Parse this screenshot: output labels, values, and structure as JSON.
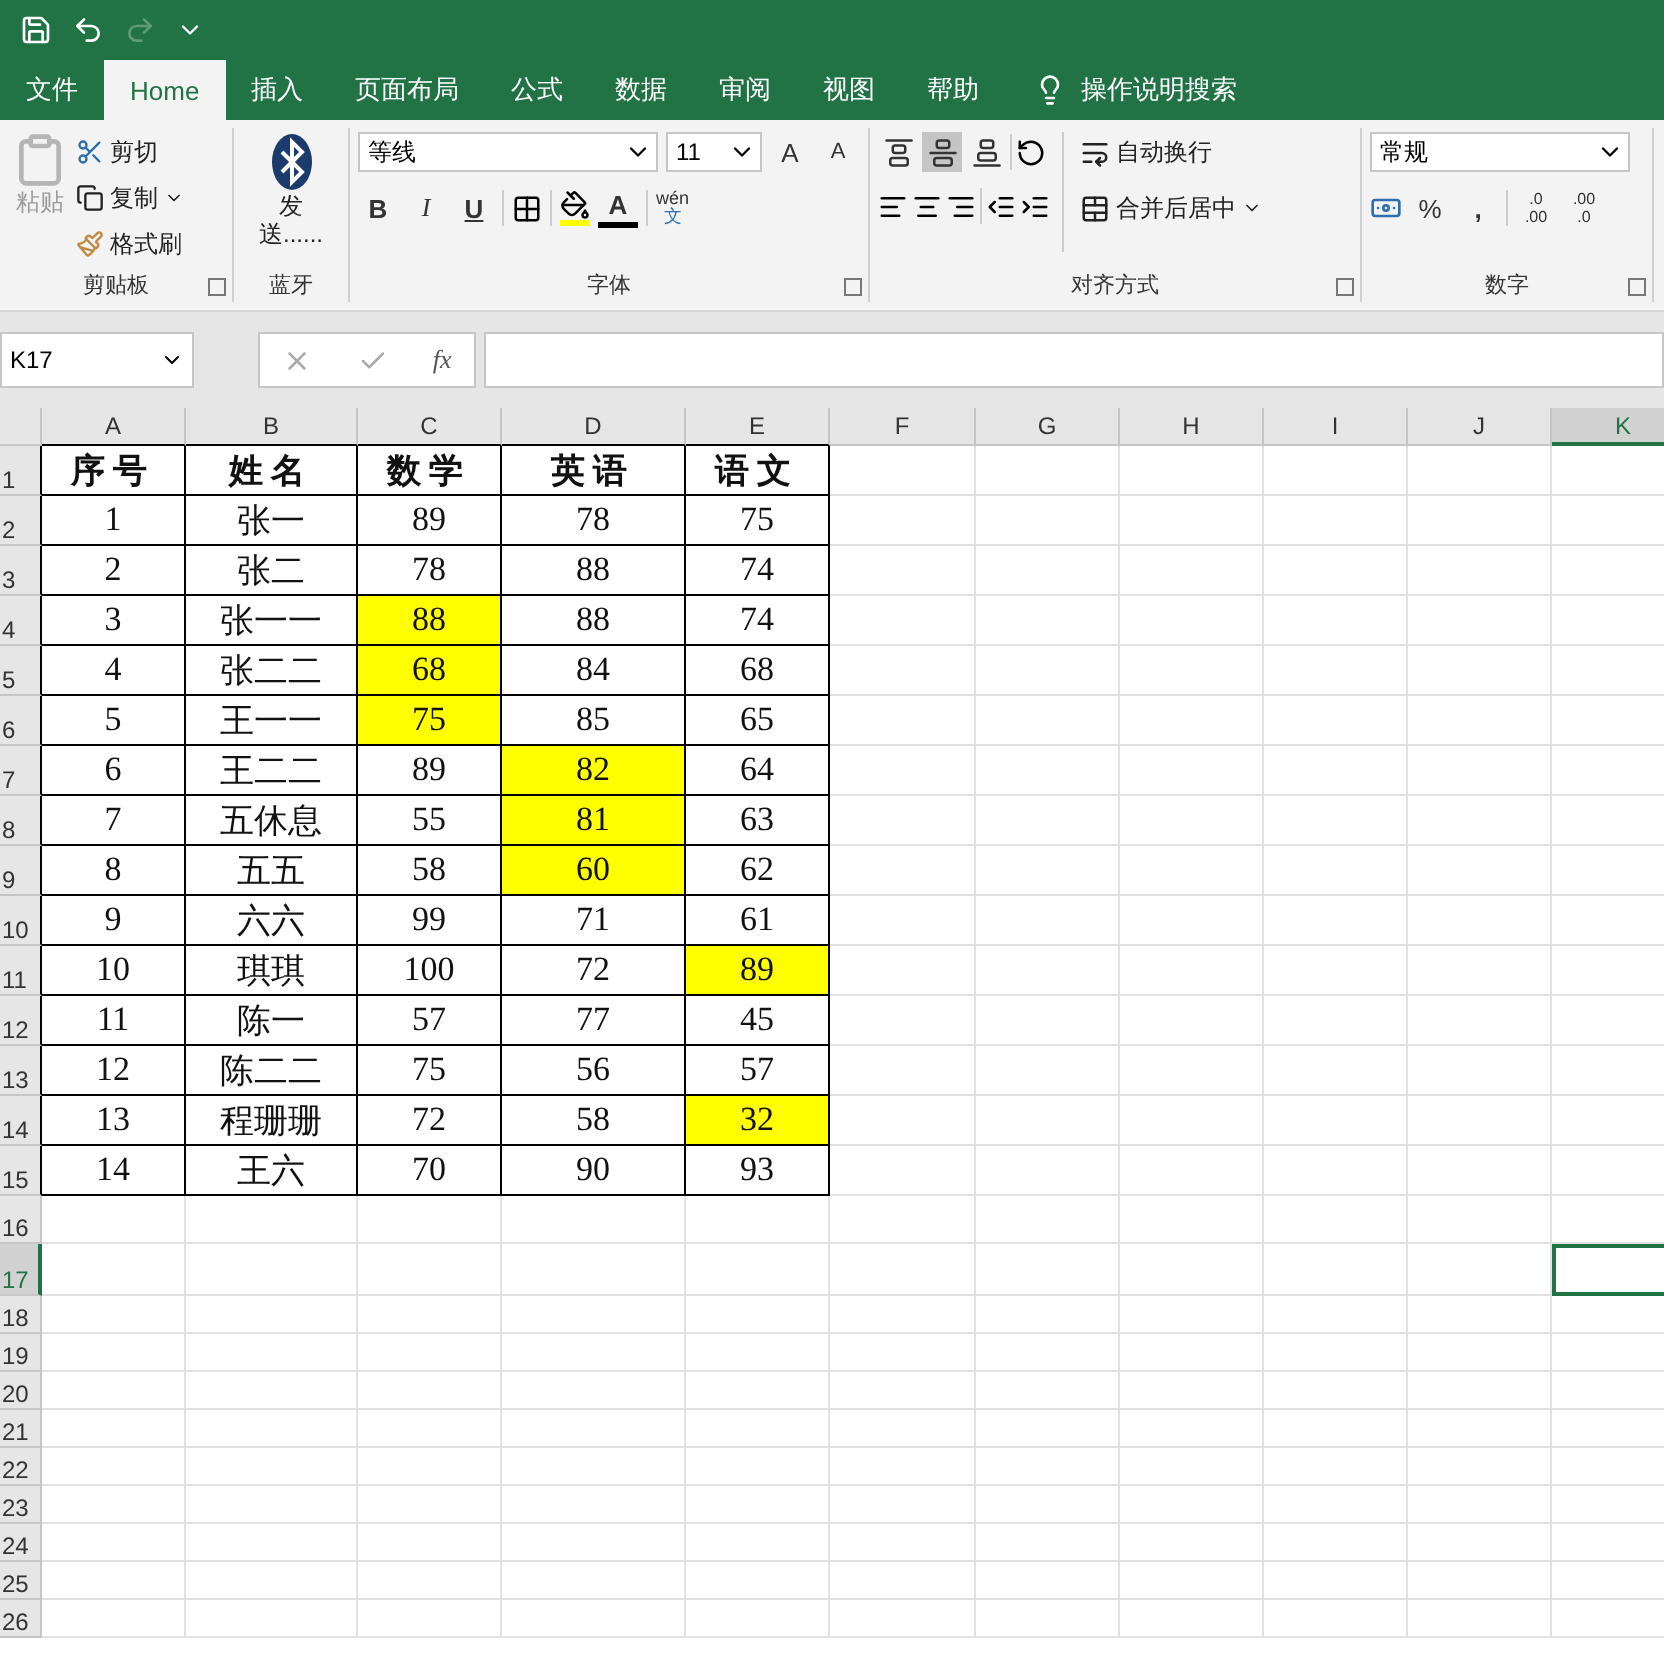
{
  "quick_access": [
    {
      "kind": "save",
      "disabled": false
    },
    {
      "kind": "undo",
      "disabled": false
    },
    {
      "kind": "redo",
      "disabled": true
    },
    {
      "kind": "customize",
      "disabled": false
    }
  ],
  "tabs": [
    {
      "label": "文件",
      "selected": false
    },
    {
      "label": "Home",
      "selected": true
    },
    {
      "label": "插入",
      "selected": false
    },
    {
      "label": "页面布局",
      "selected": false
    },
    {
      "label": "公式",
      "selected": false
    },
    {
      "label": "数据",
      "selected": false
    },
    {
      "label": "审阅",
      "selected": false
    },
    {
      "label": "视图",
      "selected": false
    },
    {
      "label": "帮助",
      "selected": false
    }
  ],
  "tell_me": "操作说明搜索",
  "clipboard": {
    "label": "剪贴板",
    "paste": {
      "label": "粘贴",
      "disabled": true
    },
    "cut": "剪切",
    "copy": "复制",
    "format_painter": "格式刷"
  },
  "bluetooth": {
    "label": "蓝牙",
    "send": "发送......"
  },
  "font": {
    "label": "字体",
    "name": "等线",
    "size": "11",
    "grow": "A",
    "shrink": "A",
    "bold": "B",
    "italic": "I",
    "underline": "U",
    "font_color": "A",
    "phonetic_top": "wén",
    "phonetic_bottom": "文"
  },
  "alignment": {
    "label": "对齐方式",
    "vertical": [
      {
        "kind": "top",
        "selected": false
      },
      {
        "kind": "middle",
        "selected": true
      },
      {
        "kind": "bottom",
        "selected": false
      }
    ],
    "wrap": "自动换行",
    "merge": "合并后居中"
  },
  "number": {
    "label": "数字",
    "format": "常规",
    "percent": "%",
    "comma": ",",
    "increase_decimal": [
      ".0",
      ".00"
    ],
    "decrease_decimal": [
      ".00",
      ".0"
    ]
  },
  "formula_bar": {
    "name_box": "K17",
    "function": "fx"
  },
  "columns": [
    {
      "letter": "A",
      "selected": false
    },
    {
      "letter": "B",
      "selected": false
    },
    {
      "letter": "C",
      "selected": false
    },
    {
      "letter": "D",
      "selected": false
    },
    {
      "letter": "E",
      "selected": false
    },
    {
      "letter": "F",
      "selected": false
    },
    {
      "letter": "G",
      "selected": false
    },
    {
      "letter": "H",
      "selected": false
    },
    {
      "letter": "I",
      "selected": false
    },
    {
      "letter": "J",
      "selected": false
    },
    {
      "letter": "K",
      "selected": true
    }
  ],
  "rows": [
    {
      "number": "1",
      "kind": "header",
      "selected": false,
      "cells": [
        {
          "text": "序号",
          "highlighted": false
        },
        {
          "text": "姓名",
          "highlighted": false
        },
        {
          "text": "数学",
          "highlighted": false
        },
        {
          "text": "英语",
          "highlighted": false
        },
        {
          "text": "语文",
          "highlighted": false
        }
      ]
    },
    {
      "number": "2",
      "kind": "data",
      "selected": false,
      "cells": [
        {
          "text": "1",
          "highlighted": false
        },
        {
          "text": "张一",
          "highlighted": false
        },
        {
          "text": "89",
          "highlighted": false
        },
        {
          "text": "78",
          "highlighted": false
        },
        {
          "text": "75",
          "highlighted": false
        }
      ]
    },
    {
      "number": "3",
      "kind": "data",
      "selected": false,
      "cells": [
        {
          "text": "2",
          "highlighted": false
        },
        {
          "text": "张二",
          "highlighted": false
        },
        {
          "text": "78",
          "highlighted": false
        },
        {
          "text": "88",
          "highlighted": false
        },
        {
          "text": "74",
          "highlighted": false
        }
      ]
    },
    {
      "number": "4",
      "kind": "data",
      "selected": false,
      "cells": [
        {
          "text": "3",
          "highlighted": false
        },
        {
          "text": "张一一",
          "highlighted": false
        },
        {
          "text": "88",
          "highlighted": true
        },
        {
          "text": "88",
          "highlighted": false
        },
        {
          "text": "74",
          "highlighted": false
        }
      ]
    },
    {
      "number": "5",
      "kind": "data",
      "selected": false,
      "cells": [
        {
          "text": "4",
          "highlighted": false
        },
        {
          "text": "张二二",
          "highlighted": false
        },
        {
          "text": "68",
          "highlighted": true
        },
        {
          "text": "84",
          "highlighted": false
        },
        {
          "text": "68",
          "highlighted": false
        }
      ]
    },
    {
      "number": "6",
      "kind": "data",
      "selected": false,
      "cells": [
        {
          "text": "5",
          "highlighted": false
        },
        {
          "text": "王一一",
          "highlighted": false
        },
        {
          "text": "75",
          "highlighted": true
        },
        {
          "text": "85",
          "highlighted": false
        },
        {
          "text": "65",
          "highlighted": false
        }
      ]
    },
    {
      "number": "7",
      "kind": "data",
      "selected": false,
      "cells": [
        {
          "text": "6",
          "highlighted": false
        },
        {
          "text": "王二二",
          "highlighted": false
        },
        {
          "text": "89",
          "highlighted": false
        },
        {
          "text": "82",
          "highlighted": true
        },
        {
          "text": "64",
          "highlighted": false
        }
      ]
    },
    {
      "number": "8",
      "kind": "data",
      "selected": false,
      "cells": [
        {
          "text": "7",
          "highlighted": false
        },
        {
          "text": "五休息",
          "highlighted": false
        },
        {
          "text": "55",
          "highlighted": false
        },
        {
          "text": "81",
          "highlighted": true
        },
        {
          "text": "63",
          "highlighted": false
        }
      ]
    },
    {
      "number": "9",
      "kind": "data",
      "selected": false,
      "cells": [
        {
          "text": "8",
          "highlighted": false
        },
        {
          "text": "五五",
          "highlighted": false
        },
        {
          "text": "58",
          "highlighted": false
        },
        {
          "text": "60",
          "highlighted": true
        },
        {
          "text": "62",
          "highlighted": false
        }
      ]
    },
    {
      "number": "10",
      "kind": "data",
      "selected": false,
      "cells": [
        {
          "text": "9",
          "highlighted": false
        },
        {
          "text": "六六",
          "highlighted": false
        },
        {
          "text": "99",
          "highlighted": false
        },
        {
          "text": "71",
          "highlighted": false
        },
        {
          "text": "61",
          "highlighted": false
        }
      ]
    },
    {
      "number": "11",
      "kind": "data",
      "selected": false,
      "cells": [
        {
          "text": "10",
          "highlighted": false
        },
        {
          "text": "琪琪",
          "highlighted": false
        },
        {
          "text": "100",
          "highlighted": false
        },
        {
          "text": "72",
          "highlighted": false
        },
        {
          "text": "89",
          "highlighted": true
        }
      ]
    },
    {
      "number": "12",
      "kind": "data",
      "selected": false,
      "cells": [
        {
          "text": "11",
          "highlighted": false
        },
        {
          "text": "陈一",
          "highlighted": false
        },
        {
          "text": "57",
          "highlighted": false
        },
        {
          "text": "77",
          "highlighted": false
        },
        {
          "text": "45",
          "highlighted": false
        }
      ]
    },
    {
      "number": "13",
      "kind": "data",
      "selected": false,
      "cells": [
        {
          "text": "12",
          "highlighted": false
        },
        {
          "text": "陈二二",
          "highlighted": false
        },
        {
          "text": "75",
          "highlighted": false
        },
        {
          "text": "56",
          "highlighted": false
        },
        {
          "text": "57",
          "highlighted": false
        }
      ]
    },
    {
      "number": "14",
      "kind": "data",
      "selected": false,
      "cells": [
        {
          "text": "13",
          "highlighted": false
        },
        {
          "text": "程珊珊",
          "highlighted": false
        },
        {
          "text": "72",
          "highlighted": false
        },
        {
          "text": "58",
          "highlighted": false
        },
        {
          "text": "32",
          "highlighted": true
        }
      ]
    },
    {
      "number": "15",
      "kind": "data",
      "selected": false,
      "cells": [
        {
          "text": "14",
          "highlighted": false
        },
        {
          "text": "王六",
          "highlighted": false
        },
        {
          "text": "70",
          "highlighted": false
        },
        {
          "text": "90",
          "highlighted": false
        },
        {
          "text": "93",
          "highlighted": false
        }
      ]
    },
    {
      "number": "16",
      "kind": "empty",
      "selected": false,
      "cells": []
    },
    {
      "number": "17",
      "kind": "empty",
      "selected": true,
      "cells": []
    },
    {
      "number": "18",
      "kind": "empty",
      "selected": false,
      "cells": []
    },
    {
      "number": "19",
      "kind": "empty",
      "selected": false,
      "cells": []
    },
    {
      "number": "20",
      "kind": "empty",
      "selected": false,
      "cells": []
    },
    {
      "number": "21",
      "kind": "empty",
      "selected": false,
      "cells": []
    },
    {
      "number": "22",
      "kind": "empty",
      "selected": false,
      "cells": []
    },
    {
      "number": "23",
      "kind": "empty",
      "selected": false,
      "cells": []
    },
    {
      "number": "24",
      "kind": "empty",
      "selected": false,
      "cells": []
    },
    {
      "number": "25",
      "kind": "empty",
      "selected": false,
      "cells": []
    },
    {
      "number": "26",
      "kind": "empty",
      "selected": false,
      "cells": []
    }
  ]
}
